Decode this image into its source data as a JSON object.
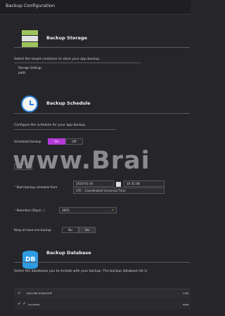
{
  "window": {
    "title": "Backup Configuration"
  },
  "storage": {
    "title": "Backup Storage",
    "description": "Select the target container to store your app backup.",
    "settings_label": "Storage Settings",
    "settings_value": "pettt"
  },
  "schedule": {
    "title": "Backup Schedule",
    "description": "Configure the schedule for your app backup.",
    "scheduled_label": "Scheduled backup",
    "on_label": "On",
    "off_label": "Off",
    "frequency_value": "1",
    "start_label": "Start backup schedule from",
    "start_date": "2018-01-20",
    "start_time": "16:31:08",
    "timezone": "UTC - Coordinated Universal Time",
    "retention_label": "Retention (Days)",
    "retention_value": "3655",
    "keep_label": "Keep at least one backup",
    "keep_no": "No",
    "keep_yes": "Yes"
  },
  "database": {
    "title": "Backup Database",
    "icon_text": "DB",
    "description": "Select the databases you to include with your backup. The backup database list is",
    "table_header": "INCLUDE IN BACKUP",
    "table_header_right": "CON",
    "row_value": "Included",
    "row_right": "defa"
  },
  "watermark": "www.Brai",
  "colors": {
    "accent_purple": "#b539d8",
    "storage_green": "#9ec55b",
    "db_blue": "#2f9be0",
    "check_green": "#8cc63f"
  }
}
